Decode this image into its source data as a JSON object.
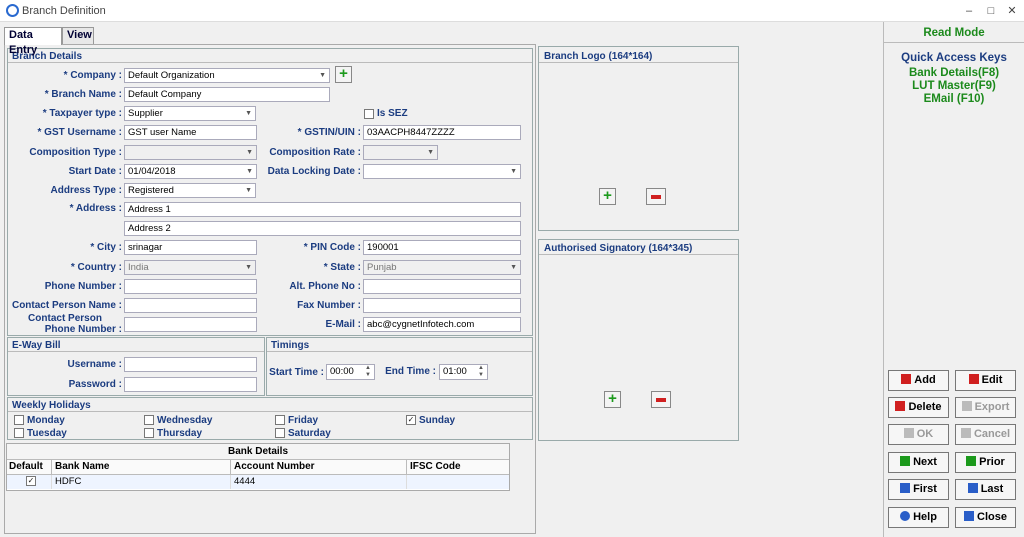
{
  "window": {
    "title": "Branch Definition",
    "min": "‒",
    "max": "□",
    "close": "✕"
  },
  "tabs": [
    "Data Entry",
    "View"
  ],
  "branch_details": {
    "title": "Branch Details",
    "company": {
      "label": "* Company :",
      "value": "Default Organization"
    },
    "branch_name": {
      "label": "* Branch Name :",
      "value": "Default Company"
    },
    "taxpayer": {
      "label": "* Taxpayer type :",
      "value": "Supplier"
    },
    "is_sez": {
      "label": "Is SEZ",
      "checked": false
    },
    "gst_username": {
      "label": "* GST Username :",
      "value": "GST user Name"
    },
    "gstin": {
      "label": "* GSTIN/UIN :",
      "value": "03AACPH8447ZZZZ"
    },
    "composition_type": {
      "label": "Composition Type :",
      "value": ""
    },
    "composition_rate": {
      "label": "Composition Rate :",
      "value": ""
    },
    "start_date": {
      "label": "Start Date :",
      "value": "01/04/2018"
    },
    "locking_date": {
      "label": "Data Locking Date :",
      "value": ""
    },
    "address_type": {
      "label": "Address Type :",
      "value": "Registered"
    },
    "address": {
      "label": "* Address :",
      "line1": "Address 1",
      "line2": "Address 2"
    },
    "city": {
      "label": "* City :",
      "value": "srinagar"
    },
    "pin": {
      "label": "* PIN Code :",
      "value": "190001"
    },
    "country": {
      "label": "* Country :",
      "value": "India"
    },
    "state": {
      "label": "* State :",
      "value": "Punjab"
    },
    "phone": {
      "label": "Phone Number :",
      "value": ""
    },
    "alt_phone": {
      "label": "Alt. Phone No :",
      "value": ""
    },
    "contact_name": {
      "label": "Contact Person Name :",
      "value": ""
    },
    "fax": {
      "label": "Fax Number :",
      "value": ""
    },
    "contact_phone": {
      "label1": "Contact Person",
      "label2": "Phone Number :",
      "value": ""
    },
    "email": {
      "label": "E-Mail :",
      "value": "abc@cygnetInfotech.com"
    }
  },
  "eway": {
    "title": "E-Way Bill",
    "username_label": "Username :",
    "password_label": "Password :",
    "username": "",
    "password": ""
  },
  "timings": {
    "title": "Timings",
    "start_label": "Start Time :",
    "start": "00:00",
    "end_label": "End Time :",
    "end": "01:00"
  },
  "holidays": {
    "title": "Weekly Holidays",
    "days": [
      {
        "name": "Monday",
        "checked": false
      },
      {
        "name": "Tuesday",
        "checked": false
      },
      {
        "name": "Wednesday",
        "checked": false
      },
      {
        "name": "Thursday",
        "checked": false
      },
      {
        "name": "Friday",
        "checked": false
      },
      {
        "name": "Saturday",
        "checked": false
      },
      {
        "name": "Sunday",
        "checked": true
      }
    ]
  },
  "bank": {
    "title": "Bank Details",
    "headers": [
      "Default",
      "Bank Name",
      "Account Number",
      "IFSC Code"
    ],
    "rows": [
      {
        "default": true,
        "bank": "HDFC",
        "account": "4444",
        "ifsc": ""
      }
    ]
  },
  "logo": {
    "title": "Branch Logo (164*164)"
  },
  "signatory": {
    "title": "Authorised Signatory (164*345)"
  },
  "right": {
    "mode": "Read Mode",
    "qa_title": "Quick Access Keys",
    "keys": [
      "Bank Details(F8)",
      "LUT Master(F9)",
      "EMail (F10)"
    ]
  },
  "buttons": {
    "add": "Add",
    "edit": "Edit",
    "delete": "Delete",
    "export": "Export",
    "ok": "OK",
    "cancel": "Cancel",
    "next": "Next",
    "prior": "Prior",
    "first": "First",
    "last": "Last",
    "help": "Help",
    "close": "Close"
  },
  "colors": {
    "accent_green": "#1c8a1c",
    "label_blue": "#1b3c80"
  }
}
